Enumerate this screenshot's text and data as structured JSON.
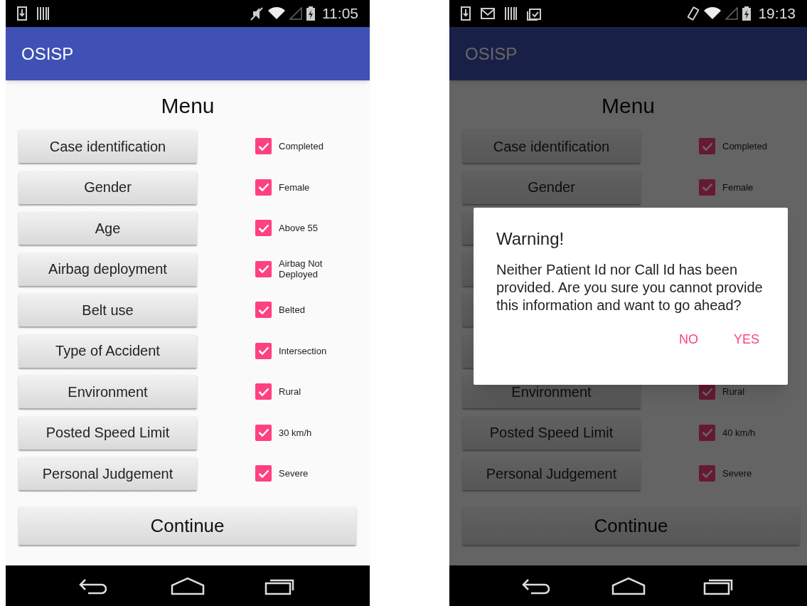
{
  "screens": [
    {
      "status_bar": {
        "icons": [
          {
            "kind": "download"
          },
          {
            "kind": "bars"
          }
        ],
        "system_icons": [
          {
            "kind": "muted"
          },
          {
            "kind": "wifi"
          },
          {
            "kind": "signal"
          },
          {
            "kind": "battery"
          }
        ],
        "time": "11:05"
      },
      "app_bar": {
        "title": "OSISP"
      },
      "heading": "Menu",
      "rows": [
        {
          "label": "Case identification",
          "checked": true,
          "status": "Completed"
        },
        {
          "label": "Gender",
          "checked": true,
          "status": "Female"
        },
        {
          "label": "Age",
          "checked": true,
          "status": "Above 55"
        },
        {
          "label": "Airbag deployment",
          "checked": true,
          "status": "Airbag Not Deployed"
        },
        {
          "label": "Belt use",
          "checked": true,
          "status": "Belted"
        },
        {
          "label": "Type of Accident",
          "checked": true,
          "status": "Intersection"
        },
        {
          "label": "Environment",
          "checked": true,
          "status": "Rural"
        },
        {
          "label": "Posted Speed Limit",
          "checked": true,
          "status": "30 km/h"
        },
        {
          "label": "Personal Judgement",
          "checked": true,
          "status": "Severe"
        }
      ],
      "continue_button": "Continue"
    },
    {
      "status_bar": {
        "icons": [
          {
            "kind": "download"
          },
          {
            "kind": "mail"
          },
          {
            "kind": "bars"
          },
          {
            "kind": "clipboard"
          }
        ],
        "system_icons": [
          {
            "kind": "vibrate"
          },
          {
            "kind": "wifi"
          },
          {
            "kind": "signal"
          },
          {
            "kind": "battery"
          }
        ],
        "time": "19:13"
      },
      "app_bar": {
        "title": "OSISP"
      },
      "heading": "Menu",
      "rows": [
        {
          "label": "Case identification",
          "checked": true,
          "status": "Completed"
        },
        {
          "label": "Gender",
          "checked": true,
          "status": "Female"
        },
        {},
        {},
        {},
        {},
        {
          "label": "Environment",
          "checked": true,
          "status": "Rural"
        },
        {
          "label": "Posted Speed Limit",
          "checked": true,
          "status": "40 km/h"
        },
        {
          "label": "Personal Judgement",
          "checked": true,
          "status": "Severe"
        }
      ],
      "continue_button": "Continue",
      "dialog": {
        "title": "Warning!",
        "message": "Neither Patient Id nor Call Id has been provided. Are you sure you cannot provide this information and want to go ahead?",
        "buttons": [
          "NO",
          "YES"
        ]
      }
    }
  ]
}
